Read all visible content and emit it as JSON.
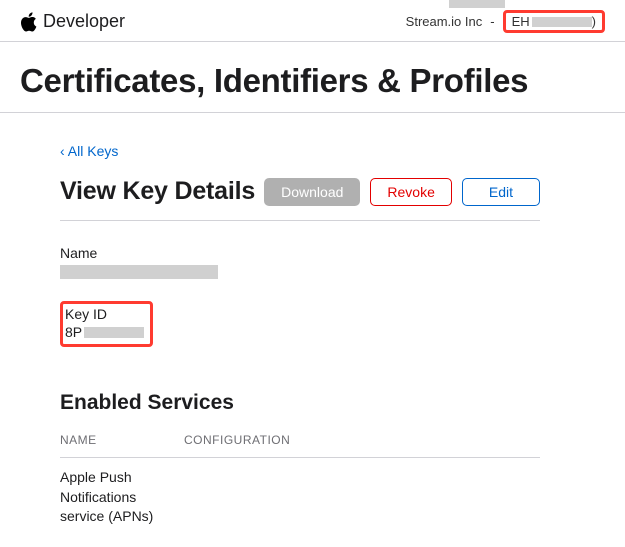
{
  "header": {
    "brand": "Developer",
    "company": "Stream.io Inc",
    "team_id_prefix": "EH",
    "team_id_suffix": ")"
  },
  "page": {
    "title": "Certificates, Identifiers & Profiles",
    "back_link": "All Keys",
    "section_title": "View Key Details",
    "buttons": {
      "download": "Download",
      "revoke": "Revoke",
      "edit": "Edit"
    },
    "fields": {
      "name_label": "Name",
      "keyid_label": "Key ID",
      "keyid_prefix": "8P"
    },
    "services": {
      "heading": "Enabled Services",
      "col_name": "NAME",
      "col_config": "CONFIGURATION",
      "rows": [
        {
          "name": "Apple Push Notifications service (APNs)",
          "config": ""
        }
      ]
    }
  }
}
